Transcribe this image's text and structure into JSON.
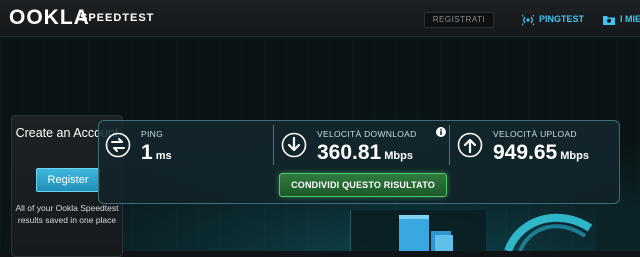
{
  "header": {
    "logo": "OOKLA",
    "subtitle": "SPEEDTEST",
    "register_label": "REGISTRATI",
    "nav": [
      {
        "label": "PINGTEST",
        "icon": "pingtest-icon"
      },
      {
        "label": "I MIEI",
        "icon": "folder-icon"
      }
    ]
  },
  "create_account": {
    "title": "Create an Account",
    "button_label": "Register",
    "note": "All of your Ookla Speedtest results saved in one place"
  },
  "results": {
    "ping": {
      "label": "PING",
      "value": "1",
      "unit": "ms",
      "icon": "ping-arrows-icon"
    },
    "download": {
      "label": "VELOCITÀ DOWNLOAD",
      "value": "360.81",
      "unit": "Mbps",
      "icon": "download-arrow-icon"
    },
    "upload": {
      "label": "VELOCITÀ UPLOAD",
      "value": "949.65",
      "unit": "Mbps",
      "icon": "upload-arrow-icon"
    },
    "share_label": "CONDIVIDI QUESTO RISULTATO"
  },
  "colors": {
    "accent": "#3fc4f0",
    "share_green": "#4fc76b",
    "panel_border": "#3e6e76"
  }
}
